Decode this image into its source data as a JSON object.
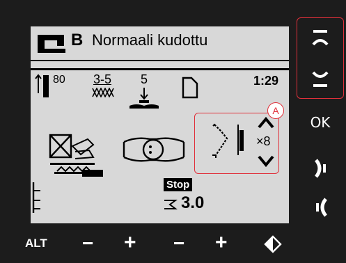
{
  "header": {
    "presser_foot_letter": "B",
    "title": "Normaali kudottu"
  },
  "status_row": {
    "needle_position": "80",
    "stitch_width": "3-5",
    "presser_foot_pressure": "5",
    "time": "1:29"
  },
  "controls": {
    "repeat_count": "×8",
    "stop_label": "Stop",
    "stitch_length": "3.0"
  },
  "callout": {
    "label": "A"
  },
  "side_buttons": {
    "ok_label": "OK"
  },
  "bottom_buttons": {
    "alt_label": "ALT",
    "minus_label": "−",
    "plus_label": "+"
  },
  "colors": {
    "device_body": "#1c1c1c",
    "lcd_background": "#d8d8d8",
    "highlight": "#e0303a"
  },
  "icons": [
    "sewing-machine-icon",
    "needle-icon",
    "zigzag-icon",
    "presser-foot-icon",
    "thread-spool-icon",
    "stitch-width-icon",
    "foot-grid-icon",
    "stitch-mode-icon",
    "stitch-sequence-icon",
    "stitch-length-icon",
    "arrow-up-icon",
    "arrow-down-icon",
    "chevron-right-icon",
    "chevron-left-icon",
    "diamond-icon"
  ]
}
